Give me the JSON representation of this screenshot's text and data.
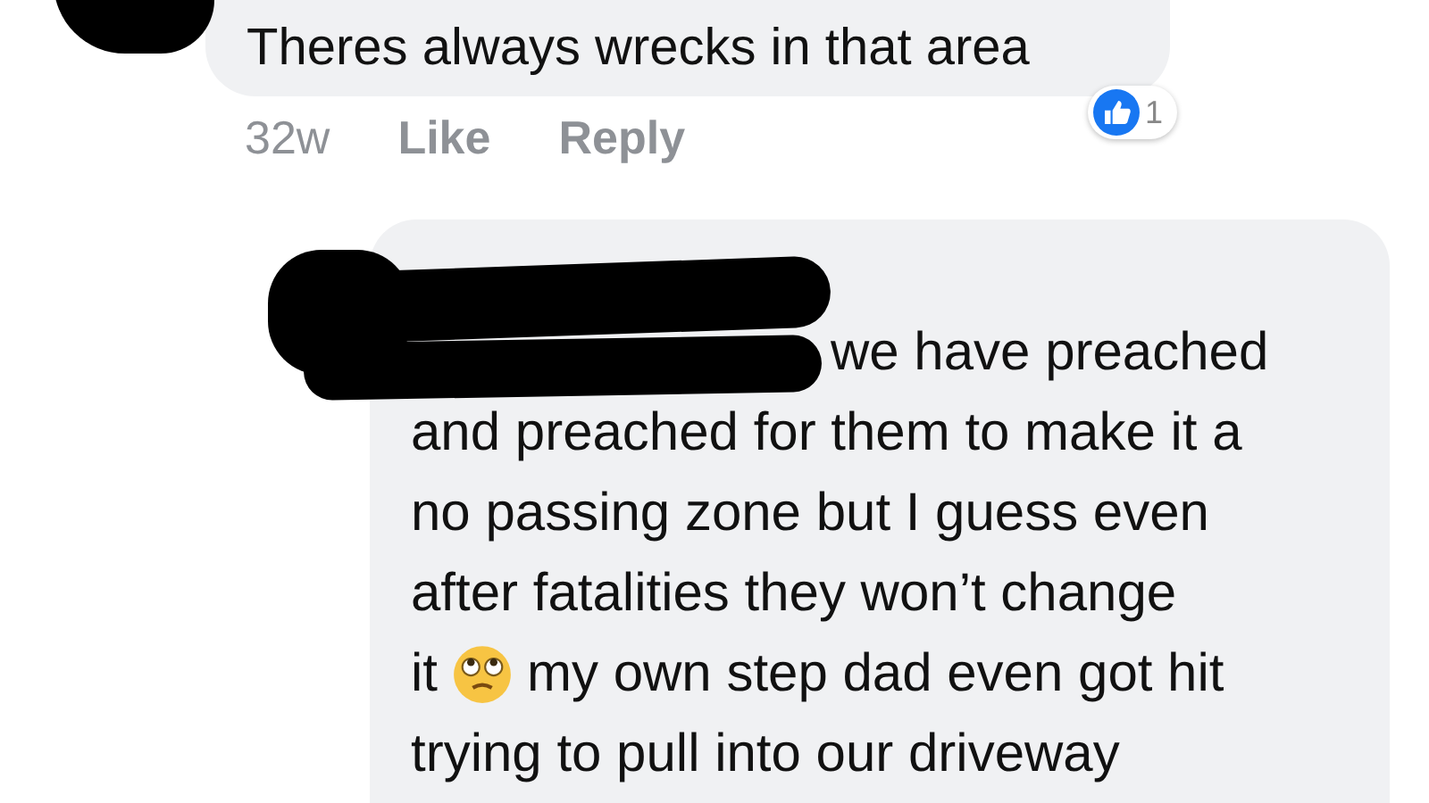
{
  "comments": [
    {
      "text": "Theres always wrecks in that area",
      "time": "32w",
      "actions": [
        "Like",
        "Reply"
      ],
      "reaction_count": "1"
    },
    {
      "lines": [
        {
          "kind": "text",
          "text": "we have preached"
        },
        {
          "kind": "text",
          "text": "and preached for them to make it a"
        },
        {
          "kind": "text",
          "text": "no passing zone but I guess even"
        },
        {
          "kind": "text",
          "text": "after fatalities they won’t change"
        },
        {
          "kind": "emoji",
          "before": "it",
          "after": "my own step dad even got hit"
        },
        {
          "kind": "text",
          "text": "trying to pull into our driveway"
        }
      ]
    }
  ]
}
